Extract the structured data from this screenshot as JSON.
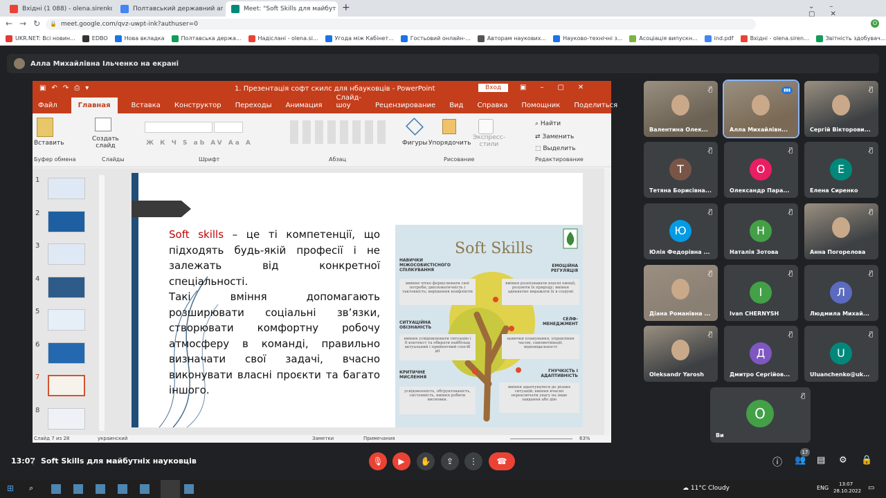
{
  "browser": {
    "tabs": [
      {
        "label": "Вхідні (1 088) - olena.sirenko@p",
        "color": "#ea4335"
      },
      {
        "label": "Полтавський державний аграр",
        "color": "#4285f4"
      },
      {
        "label": "Meet: \"Soft Skills для майбут",
        "color": "#00897b"
      }
    ],
    "new_tab": "+",
    "url": "meet.google.com/qvz-uwpt-ink?authuser=0",
    "bookmarks": [
      "UKR.NET: Всі новин...",
      "EDBO",
      "Нова вкладка",
      "Полтавська держа...",
      "Надіслані - olena.si...",
      "Угода між Кабінет...",
      "Гостьовий онлайн-...",
      "Авторам наукових...",
      "Науково-технічні з...",
      "Асоціація випускн...",
      "ind.pdf",
      "Вхідні - olena.siren...",
      "Звітність здобувач..."
    ]
  },
  "meet": {
    "presenter_label": "Алла Михайлівна Ільченко на екрані",
    "time": "13:07",
    "meeting_title": "Soft Skills для майбутніх науковців",
    "participants_count": "17",
    "participants": [
      {
        "name": "Валентина Олек...",
        "initial": "",
        "color": "#6b6253",
        "photo": true
      },
      {
        "name": "Алла Михайлівн...",
        "initial": "",
        "color": "#7a6a55",
        "photo": true,
        "speaking": true
      },
      {
        "name": "Сергій Вікторови...",
        "initial": "",
        "color": "#3c4043",
        "photo": true
      },
      {
        "name": "Тетяна Борисівна...",
        "initial": "Т",
        "color": "#795548"
      },
      {
        "name": "Олександр Пара...",
        "initial": "О",
        "color": "#e91e63"
      },
      {
        "name": "Елена Сиренко",
        "initial": "Е",
        "color": "#00897b"
      },
      {
        "name": "Юлія Федорівна ...",
        "initial": "Ю",
        "color": "#039be5"
      },
      {
        "name": "Наталія Зотова",
        "initial": "Н",
        "color": "#43a047"
      },
      {
        "name": "Анна Погорелова",
        "initial": "",
        "color": "#3c4043",
        "photo": true
      },
      {
        "name": "Діана Романівна ...",
        "initial": "",
        "color": "#8a7f73",
        "photo": true
      },
      {
        "name": "Ivan CHERNYSH",
        "initial": "I",
        "color": "#43a047"
      },
      {
        "name": "Людмила Михай...",
        "initial": "Л",
        "color": "#5c6bc0"
      },
      {
        "name": "Oleksandr Yarosh",
        "initial": "",
        "color": "#3c4043",
        "photo": true
      },
      {
        "name": "Дмитро Сергійов...",
        "initial": "Д",
        "color": "#7e57c2"
      },
      {
        "name": "Uluanchenko@uk...",
        "initial": "U",
        "color": "#00897b"
      },
      {
        "name": "Ви",
        "initial": "О",
        "color": "#43a047"
      }
    ]
  },
  "powerpoint": {
    "title": "1. Презентація софт скилс для нбауковців  -  PowerPoint",
    "signin": "Вход",
    "tabs": [
      "Файл",
      "Главная",
      "Вставка",
      "Конструктор",
      "Переходы",
      "Анимация",
      "Слайд-шоу",
      "Рецензирование",
      "Вид",
      "Справка",
      "Помощник"
    ],
    "share": "Поделиться",
    "ribbon": {
      "paste": "Вставить",
      "new_slide": "Создать\nслайд",
      "shapes": "Фигуры",
      "arrange": "Упорядочить",
      "express": "Экспресс-\nстили",
      "find": "Найти",
      "replace": "Заменить",
      "select": "Выделить",
      "groups": [
        "Буфер обмена",
        "Слайды",
        "Шрифт",
        "Абзац",
        "Рисование",
        "Редактирование"
      ],
      "font_buttons": "Ж К Ч S ab AV Аа A"
    },
    "slide_numbers": [
      "1",
      "2",
      "3",
      "4",
      "5",
      "6",
      "7",
      "8"
    ],
    "status": {
      "slide": "Слайд 7 из 28",
      "lang": "украинский",
      "notes": "Заметки",
      "comments": "Примечания",
      "zoom": "63%"
    }
  },
  "slide": {
    "lead": "Soft skills",
    "para1": " – це ті компетенції, що підходять будь-якій професії і не залежать від конкретної спеціальності.",
    "para2": "Такі вміння допомагають розширювати соціальні зв’язки, створювати комфортну робочу атмосферу в команді, правильно визначати свої задачі, вчасно виконувати власні проєкти та багато іншого.",
    "graphic": {
      "title": "Soft Skills",
      "labels": {
        "l1": "НАВИЧКИ МІЖОСОБИСТІСНОГО СПІЛКУВАННЯ",
        "r1": "ЕМОЦІЙНА РЕГУЛЯЦІЯ",
        "l2": "СИТУАЦІЙНА ОБІЗНАНІСТЬ",
        "r2": "СЕЛФ-МЕНЕДЖМЕНТ",
        "l3": "КРИТИЧНЕ МИСЛЕННЯ",
        "r3": "ГНУЧКІСТЬ І АДАПТИВНІСТЬ"
      },
      "boxes": {
        "l1": "вміння чітко формулювати свої потреби; дипломатичність і тактовність; вирішення конфліктів",
        "r1": "вміння розпізнавати власні емоції, розуміти їх природу; вміння адекватно виражати їх в соціумі",
        "l2": "вміння усвідомлювати ситуацію і її контекст та обирати найбільш актуальний і прийнятний спосіб дії",
        "r2": "навички планування, управління часом, самомотивації, відповідальності",
        "l3": "усвідомленість, обґрунтованість, системність, вміння робити висновки.",
        "r3": "вміння адаптуватися до різних ситуацій; вміння вчасно переключати увагу на інше завдання або дію"
      }
    }
  },
  "taskbar": {
    "weather": "11°C  Cloudy",
    "lang": "ENG",
    "time": "13:07",
    "date": "28.10.2022"
  }
}
